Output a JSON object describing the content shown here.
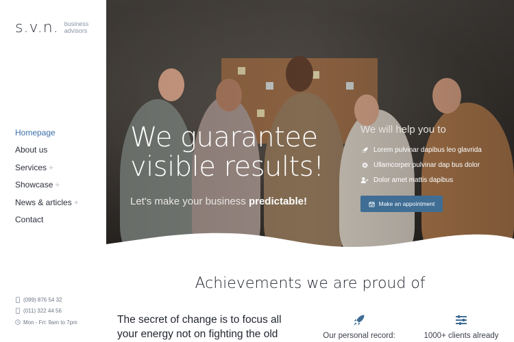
{
  "brand": {
    "mark": "s.v.n.",
    "sub_line1": "business",
    "sub_line2": "advisors"
  },
  "nav": [
    {
      "label": "Homepage",
      "active": true,
      "has_sub": false
    },
    {
      "label": "About us",
      "active": false,
      "has_sub": false
    },
    {
      "label": "Services",
      "active": false,
      "has_sub": true
    },
    {
      "label": "Showcase",
      "active": false,
      "has_sub": true
    },
    {
      "label": "News & articles",
      "active": false,
      "has_sub": true
    },
    {
      "label": "Contact",
      "active": false,
      "has_sub": false
    }
  ],
  "contact": {
    "phone1": "(099) 876 54 32",
    "phone2": "(011) 322 44 56",
    "hours": "Mon - Fri: 9am to 7pm"
  },
  "hero": {
    "title_line1": "We guarantee",
    "title_line2": "visible results!",
    "subtitle_plain": "Let's make your business ",
    "subtitle_bold": "predictable!",
    "help_title": "We will help you to",
    "help_items": [
      {
        "icon": "rocket-icon",
        "text": "Lorem pulvinar dapibus leo glavrida"
      },
      {
        "icon": "gear-icon",
        "text": "Ullamcorper pulvinar dap bus dolor"
      },
      {
        "icon": "user-check-icon",
        "text": "Dolor amet mattis dapibus"
      }
    ],
    "button_label": "Make an appointment"
  },
  "achievements": {
    "title": "Achievements we are proud of",
    "text_line1": "The secret of change is to focus all",
    "text_line2": "your energy not on fighting the old",
    "stats": [
      {
        "icon": "rocket-icon",
        "label": "Our personal record:"
      },
      {
        "icon": "sliders-icon",
        "label": "1000+ clients already"
      }
    ]
  },
  "colors": {
    "accent": "#3b6ea8",
    "button": "#3f6d94",
    "text": "#2b2f3a"
  }
}
